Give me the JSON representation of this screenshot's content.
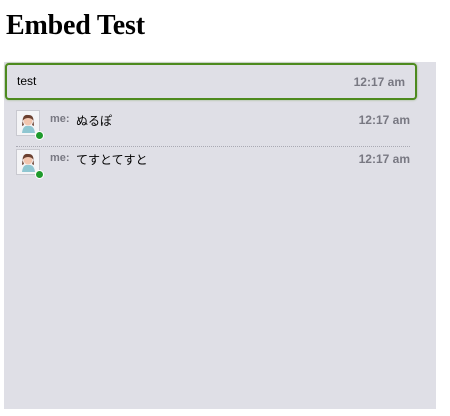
{
  "page": {
    "title": "Embed Test"
  },
  "input": {
    "value": "test",
    "time": "12:17 am"
  },
  "messages": [
    {
      "sender": "me:",
      "text": "ぬるぽ",
      "time": "12:17 am",
      "status": "online"
    },
    {
      "sender": "me:",
      "text": "てすとてすと",
      "time": "12:17 am",
      "status": "online"
    }
  ],
  "colors": {
    "panel_background": "#dfdfe6",
    "focus_border": "#4d8a1e",
    "online_dot": "#1f9a2c",
    "muted_text": "#787882"
  },
  "icons": {
    "avatar": "avatar-icon",
    "presence": "online-status-icon"
  }
}
